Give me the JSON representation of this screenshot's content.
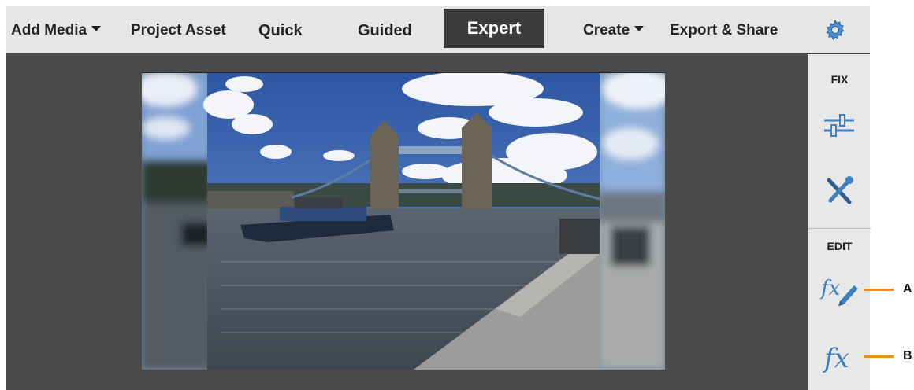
{
  "menubar": {
    "add_media": "Add Media",
    "project_asset": "Project Asset",
    "modes": {
      "quick": "Quick",
      "guided": "Guided",
      "expert": "Expert"
    },
    "create": "Create",
    "export_share": "Export & Share",
    "settings_icon": "gear-icon"
  },
  "panel": {
    "fix_label": "FIX",
    "edit_label": "EDIT",
    "tools": [
      "sliders-icon",
      "tools-icon",
      "effects-brush-icon",
      "effects-icon"
    ]
  },
  "callouts": {
    "a": "A",
    "b": "B"
  },
  "colors": {
    "accent_orange": "#f18b1a",
    "active_mode_bg": "#3b3b3b",
    "tool_blue": "#3d7fc0"
  }
}
